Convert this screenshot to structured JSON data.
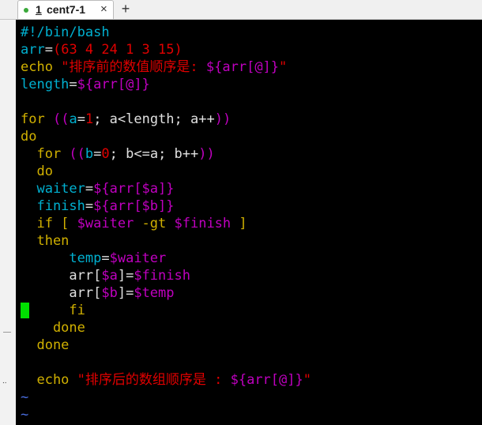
{
  "tab": {
    "number": "1",
    "title": "cent7-1",
    "close": "×"
  },
  "new_tab_label": "+",
  "left_margin_marker": "..",
  "script_lines": [
    [
      {
        "t": "#!/bin/bash",
        "c": "c-c"
      }
    ],
    [
      {
        "t": "arr",
        "c": "c-c"
      },
      {
        "t": "=",
        "c": "c-w"
      },
      {
        "t": "(63 4 24 1 3 15)",
        "c": "c-r"
      }
    ],
    [
      {
        "t": "echo ",
        "c": "c-y"
      },
      {
        "t": "\"排序前的数值顺序是: ",
        "c": "c-r"
      },
      {
        "t": "${arr[@]}",
        "c": "c-m"
      },
      {
        "t": "\"",
        "c": "c-r"
      }
    ],
    [
      {
        "t": "length",
        "c": "c-c"
      },
      {
        "t": "=",
        "c": "c-w"
      },
      {
        "t": "${arr[@]}",
        "c": "c-m"
      }
    ],
    [],
    [
      {
        "t": "for ",
        "c": "c-y"
      },
      {
        "t": "((",
        "c": "c-m"
      },
      {
        "t": "a",
        "c": "c-c"
      },
      {
        "t": "=",
        "c": "c-w"
      },
      {
        "t": "1",
        "c": "c-r"
      },
      {
        "t": "; a<length; a++",
        "c": "c-w"
      },
      {
        "t": "))",
        "c": "c-m"
      }
    ],
    [
      {
        "t": "do",
        "c": "c-y"
      }
    ],
    [
      {
        "t": "  for ",
        "c": "c-y"
      },
      {
        "t": "((",
        "c": "c-m"
      },
      {
        "t": "b",
        "c": "c-c"
      },
      {
        "t": "=",
        "c": "c-w"
      },
      {
        "t": "0",
        "c": "c-r"
      },
      {
        "t": "; b<=a; b++",
        "c": "c-w"
      },
      {
        "t": "))",
        "c": "c-m"
      }
    ],
    [
      {
        "t": "  do",
        "c": "c-y"
      }
    ],
    [
      {
        "t": "  waiter",
        "c": "c-c"
      },
      {
        "t": "=",
        "c": "c-w"
      },
      {
        "t": "${arr[$a]}",
        "c": "c-m"
      }
    ],
    [
      {
        "t": "  finish",
        "c": "c-c"
      },
      {
        "t": "=",
        "c": "c-w"
      },
      {
        "t": "${arr[$b]}",
        "c": "c-m"
      }
    ],
    [
      {
        "t": "  if [ ",
        "c": "c-y"
      },
      {
        "t": "$waiter",
        "c": "c-m"
      },
      {
        "t": " -gt ",
        "c": "c-y"
      },
      {
        "t": "$finish",
        "c": "c-m"
      },
      {
        "t": " ]",
        "c": "c-y"
      }
    ],
    [
      {
        "t": "  then",
        "c": "c-y"
      }
    ],
    [
      {
        "t": "      temp",
        "c": "c-c"
      },
      {
        "t": "=",
        "c": "c-w"
      },
      {
        "t": "$waiter",
        "c": "c-m"
      }
    ],
    [
      {
        "t": "      arr[",
        "c": "c-w"
      },
      {
        "t": "$a",
        "c": "c-m"
      },
      {
        "t": "]=",
        "c": "c-w"
      },
      {
        "t": "$finish",
        "c": "c-m"
      }
    ],
    [
      {
        "t": "      arr[",
        "c": "c-w"
      },
      {
        "t": "$b",
        "c": "c-m"
      },
      {
        "t": "]=",
        "c": "c-w"
      },
      {
        "t": "$temp",
        "c": "c-m"
      }
    ],
    [
      {
        "t": "      fi",
        "c": "c-y"
      }
    ],
    [
      {
        "t": "    done",
        "c": "c-y"
      }
    ],
    [
      {
        "t": "  done",
        "c": "c-y"
      }
    ],
    [],
    [
      {
        "t": "  echo ",
        "c": "c-y"
      },
      {
        "t": "\"排序后的数组顺序是 : ",
        "c": "c-r"
      },
      {
        "t": "${arr[@]}",
        "c": "c-m"
      },
      {
        "t": "\"",
        "c": "c-r"
      }
    ],
    [
      {
        "t": "~",
        "c": "tilde"
      }
    ],
    [
      {
        "t": "~",
        "c": "tilde"
      }
    ]
  ],
  "colors": {
    "background": "#000000",
    "keyword": "#d0b000",
    "variable": "#c000c0",
    "identifier": "#00b0d0",
    "string": "#e00000",
    "cursor": "#00e000",
    "tab_dot": "#3aa93a"
  }
}
